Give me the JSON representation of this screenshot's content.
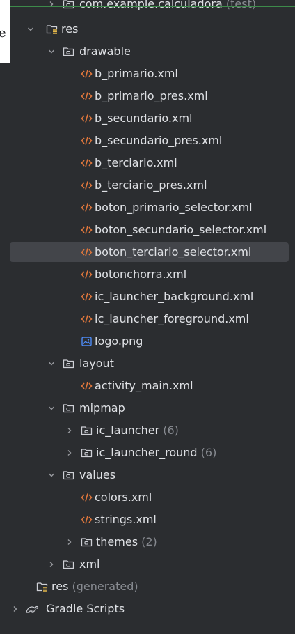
{
  "edge_char": "e",
  "tree": [
    {
      "name": "com.example.calculadora",
      "suffix": " (test)",
      "type": "package",
      "chevron": "collapsed"
    },
    {
      "name": "res",
      "type": "res-folder",
      "chevron": "expanded"
    },
    {
      "name": "drawable",
      "type": "folder",
      "chevron": "expanded"
    },
    {
      "name": "b_primario.xml",
      "type": "xml"
    },
    {
      "name": "b_primario_pres.xml",
      "type": "xml"
    },
    {
      "name": "b_secundario.xml",
      "type": "xml"
    },
    {
      "name": "b_secundario_pres.xml",
      "type": "xml"
    },
    {
      "name": "b_terciario.xml",
      "type": "xml"
    },
    {
      "name": "b_terciario_pres.xml",
      "type": "xml"
    },
    {
      "name": "boton_primario_selector.xml",
      "type": "xml"
    },
    {
      "name": "boton_secundario_selector.xml",
      "type": "xml"
    },
    {
      "name": "boton_terciario_selector.xml",
      "type": "xml",
      "selected": true
    },
    {
      "name": "botonchorra.xml",
      "type": "xml"
    },
    {
      "name": "ic_launcher_background.xml",
      "type": "xml"
    },
    {
      "name": "ic_launcher_foreground.xml",
      "type": "xml"
    },
    {
      "name": "logo.png",
      "type": "image"
    },
    {
      "name": "layout",
      "type": "folder",
      "chevron": "expanded"
    },
    {
      "name": "activity_main.xml",
      "type": "xml"
    },
    {
      "name": "mipmap",
      "type": "folder",
      "chevron": "expanded"
    },
    {
      "name": "ic_launcher",
      "suffix": " (6)",
      "type": "folder",
      "chevron": "collapsed"
    },
    {
      "name": "ic_launcher_round",
      "suffix": " (6)",
      "type": "folder",
      "chevron": "collapsed"
    },
    {
      "name": "values",
      "type": "folder",
      "chevron": "expanded"
    },
    {
      "name": "colors.xml",
      "type": "xml"
    },
    {
      "name": "strings.xml",
      "type": "xml"
    },
    {
      "name": "themes",
      "suffix": " (2)",
      "type": "folder",
      "chevron": "collapsed"
    },
    {
      "name": "xml",
      "type": "folder",
      "chevron": "collapsed"
    },
    {
      "name": "res",
      "suffix": " (generated)",
      "type": "res-folder"
    },
    {
      "name": "Gradle Scripts",
      "type": "gradle",
      "chevron": "collapsed"
    }
  ]
}
